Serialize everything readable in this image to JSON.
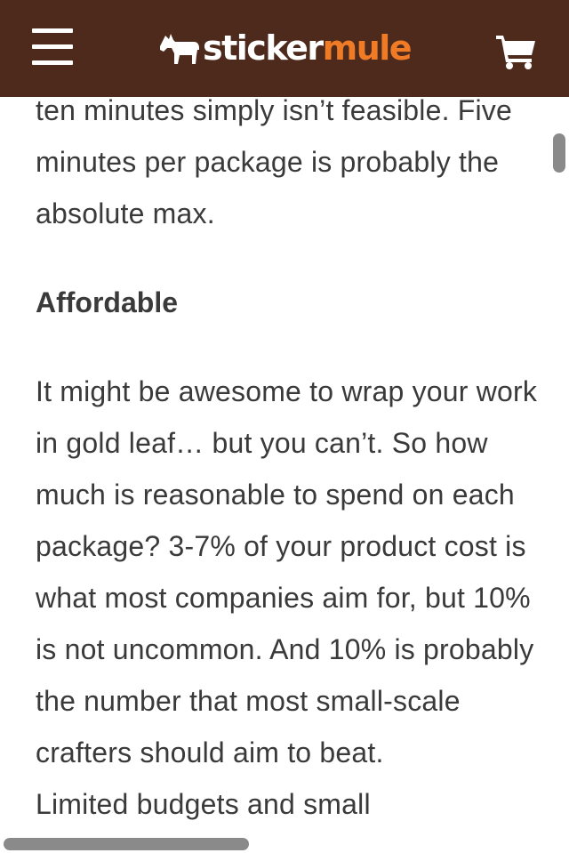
{
  "header": {
    "brand_part1": "sticker",
    "brand_part2": "mule",
    "menu_icon": "hamburger-menu-icon",
    "logo_icon": "mule-logo-icon",
    "cart_icon": "shopping-cart-icon",
    "background_color": "#4e2a1c",
    "accent_color": "#f07b27"
  },
  "article": {
    "paragraph_1": "ten minutes simply isn’t feasible. Five minutes per package is probably the absolute max.",
    "heading_affordable": "Affordable",
    "paragraph_2": "It might be awesome to wrap your work in gold leaf… but you can’t. So how much is reasonable to spend on each package? 3-7% of your product cost is what most companies aim for, but 10% is not uncommon. And 10% is probably the number that most small-scale crafters should aim to beat.",
    "paragraph_3_partial": "Limited budgets and small"
  }
}
